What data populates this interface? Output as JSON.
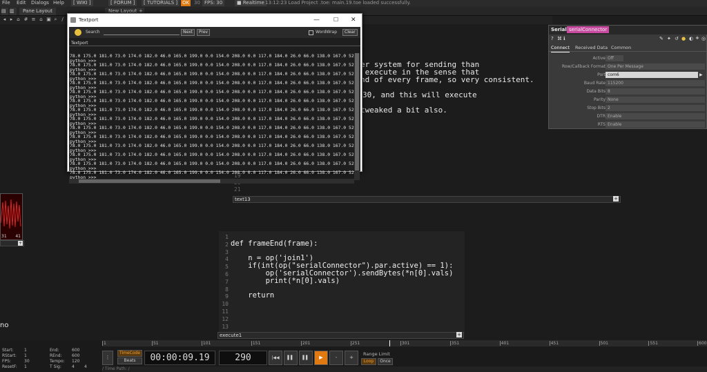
{
  "menubar": {
    "items": [
      "File",
      "Edit",
      "Dialogs",
      "Help"
    ],
    "links": [
      "[ WIKI ]",
      "[ FORUM ]",
      "[ TUTORIALS ]"
    ],
    "ok_badge": "OK",
    "fps_label": "30",
    "fps_text": "FPS: 30",
    "realtime_label": "Realtime",
    "status_message": "13:12:23 Load Project .toe: main.19.toe loaded successfully."
  },
  "tabs": {
    "pane_layout": "Pane Layout",
    "new_layout": "New Layout",
    "add": "+"
  },
  "textport": {
    "title": "Textport",
    "search_label": "Search",
    "next_label": "Next",
    "prev_label": "Prev",
    "wordwrap_label": "WordWrap",
    "clear_label": "Clear",
    "tab_label": "Textport",
    "data_line": "78.0 175.0 181.0 73.0 174.0 182.0 46.0 165.0 199.0 0.0 154.0 208.0 0.0 117.0 184.0 26.0 66.0 138.0 167.0 52.0",
    "prompt_line": "python >>>"
  },
  "text13": {
    "lines": [
      "er system for sending than",
      " execute in the sense that",
      "nd of every frame, so very consistent.",
      "",
      "30, and this will execute",
      "",
      "tweaked a bit also."
    ],
    "line_numbers": [
      "19",
      "20",
      "21"
    ],
    "label": "text13"
  },
  "execute1": {
    "line_numbers": [
      "1",
      "2",
      "3",
      "4",
      "5",
      "6",
      "7",
      "8",
      "9",
      "10",
      "11",
      "12",
      "13"
    ],
    "code": [
      "def frameEnd(frame):",
      "",
      "    n = op('join1')",
      "    if(int(op(\"serialConnector\").par.active) == 1):",
      "        op('serialConnector').sendBytes(*n[0].vals)",
      "        print(*n[0].vals)",
      "",
      "    return",
      "",
      "",
      "",
      "",
      ""
    ],
    "label": "execute1"
  },
  "chop_viewer": {
    "left_value": "31",
    "right_value": "41"
  },
  "partial_label": "no",
  "serial_panel": {
    "type": "Serial",
    "name": "serialConnector",
    "tabs": [
      "Connect",
      "Received Data",
      "Common"
    ],
    "params": [
      {
        "label": "Active",
        "value": "Off"
      },
      {
        "label": "Row/Callback Format",
        "value": "One Per Message"
      },
      {
        "label": "Port",
        "value": "com6"
      },
      {
        "label": "Baud Rate",
        "value": "115200"
      },
      {
        "label": "Data Bits",
        "value": "8"
      },
      {
        "label": "Parity",
        "value": "None"
      },
      {
        "label": "Stop Bits",
        "value": "2"
      },
      {
        "label": "DTR",
        "value": "Enable"
      },
      {
        "label": "RTS",
        "value": "Enable"
      }
    ]
  },
  "timeline": {
    "start": "1",
    "end": "600",
    "rstart": "1",
    "rend": "600",
    "fps": "30",
    "tempo": "120",
    "resetf": "1",
    "tsig_a": "4",
    "tsig_b": "4",
    "labels": {
      "start": "Start:",
      "end": "End:",
      "rstart": "RStart:",
      "rend": "REnd:",
      "fps": "FPS:",
      "tempo": "Tempo:",
      "resetf": "ResetF:",
      "tsig": "T Sig:"
    },
    "ruler_ticks": [
      "1",
      "51",
      "101",
      "151",
      "201",
      "251",
      "301",
      "351",
      "401",
      "451",
      "501",
      "551",
      "600"
    ],
    "timecode_btn": "TimeCode",
    "beats_btn": "Beats",
    "timecode": "00:00:09.19",
    "frame": "290",
    "range_limit": "Range Limit",
    "loop": "Loop",
    "once": "Once",
    "time_path": "/ Time Path: /"
  },
  "colors": {
    "accent_orange": "#e07a10",
    "panel_bg": "#3a3a3a",
    "background": "#1c1c1c"
  }
}
